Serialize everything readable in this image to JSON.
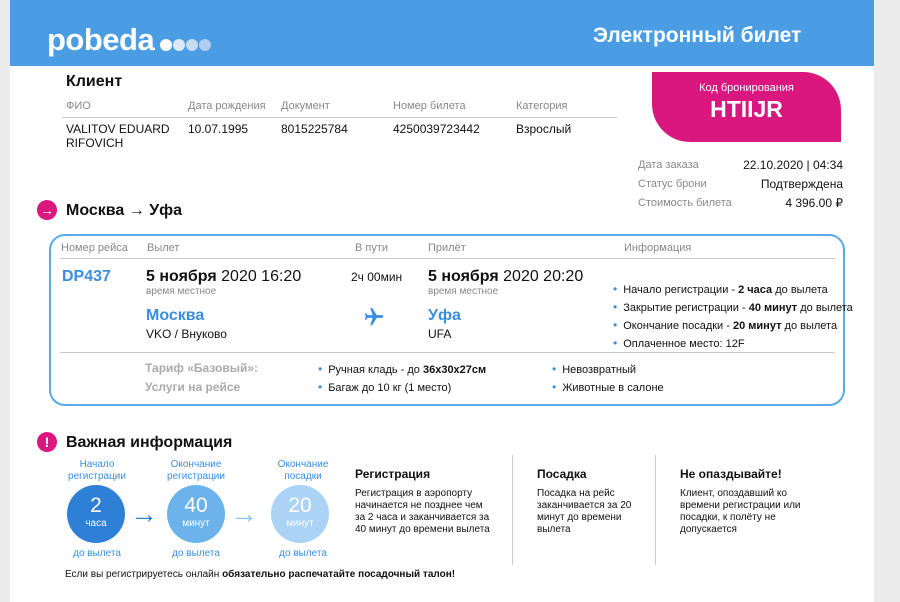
{
  "header": {
    "logo": "pobeda",
    "title": "Электронный билет",
    "dot_colors": [
      "#ffffff",
      "#dbe9f9",
      "#c4dbf4",
      "#aecdf0"
    ]
  },
  "client": {
    "section_title": "Клиент",
    "columns": [
      "ФИО",
      "Дата рождения",
      "Документ",
      "Номер билета",
      "Категория"
    ],
    "name": "VALITOV EDUARD RIFOVICH",
    "birth": "10.07.1995",
    "document": "8015225784",
    "ticket": "4250039723442",
    "category": "Взрослый"
  },
  "booking": {
    "label": "Код бронирования",
    "code": "HTIIJR",
    "color": "#d9177f",
    "order_date_label": "Дата заказа",
    "order_date": "22.10.2020 | 04:34",
    "status_label": "Статус брони",
    "status": "Подтверждена",
    "cost_label": "Стоимость билета",
    "cost": "4 396.00 ₽"
  },
  "route": {
    "icon": "arrow-right-circle-icon",
    "title": "Москва → Уфа"
  },
  "flight": {
    "headers": {
      "number": "Номер рейса",
      "departure": "Вылет",
      "duration": "В пути",
      "arrival": "Прилёт",
      "info": "Информация"
    },
    "number": "DP437",
    "dep_date": "5 ноября",
    "dep_time": "2020 16:20",
    "local_time": "время местное",
    "dep_city": "Москва",
    "dep_airport": "VKO / Внуково",
    "duration": "2ч 00мин",
    "plane_icon": "airplane-icon",
    "arr_date": "5 ноября",
    "arr_time": "2020 20:20",
    "arr_city": "Уфа",
    "arr_airport": "UFA",
    "info": {
      "reg_start_pre": "Начало регистрации - ",
      "reg_start_bold": "2 часа",
      "reg_start_post": " до вылета",
      "reg_end_pre": "Закрытие регистрации - ",
      "reg_end_bold": "40 минут",
      "reg_end_post": " до вылета",
      "board_end_pre": "Окончание посадки - ",
      "board_end_bold": "20 минут",
      "board_end_post": " до вылета",
      "seat": "Оплаченное место: 12F"
    },
    "tariff": "Тариф «Базовый»:",
    "services": "Услуги на рейсе",
    "hand_pre": "Ручная кладь - до ",
    "hand_bold": "36x30x27см",
    "baggage": "Багаж до 10 кг (1 место)",
    "nonref": "Невозвратный",
    "animals": "Животные в салоне"
  },
  "important": {
    "icon": "exclamation-circle-icon",
    "title": "Важная информация",
    "steps": [
      {
        "label": "Начало регистрации",
        "num": "2",
        "unit": "часа",
        "below": "до вылета",
        "color": "#2e7fd6"
      },
      {
        "label": "Окончание регистрации",
        "num": "40",
        "unit": "минут",
        "below": "до вылета",
        "color": "#6cb3ec"
      },
      {
        "label": "Окончание посадки",
        "num": "20",
        "unit": "минут",
        "below": "до вылета",
        "color": "#aad3f5"
      }
    ],
    "registration_title": "Регистрация",
    "registration_text": "Регистрация в аэропорту начинается не позднее чем за 2 часа и заканчивается за 40 минут до времени вылета",
    "boarding_title": "Посадка",
    "boarding_text": "Посадка на рейс заканчивается за 20 минут до времени вылета",
    "late_title": "Не опаздывайте!",
    "late_text": "Клиент, опоздавший ко времени регистрации или посадки, к полёту не допускается",
    "footer_pre": "Если вы регистрируетесь онлайн ",
    "footer_bold": "обязательно распечатайте посадочный талон!"
  }
}
